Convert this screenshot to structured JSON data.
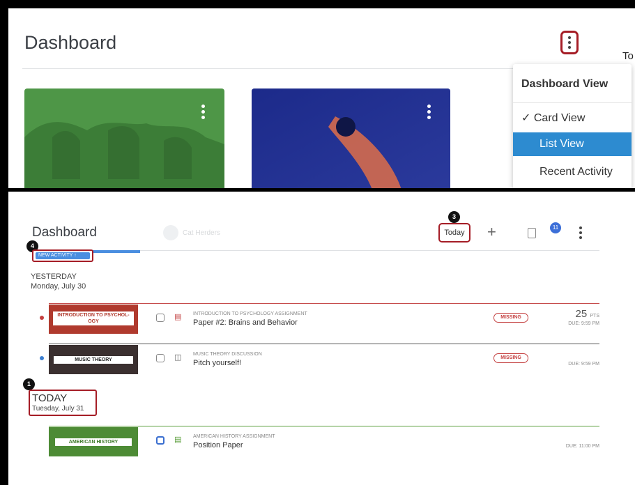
{
  "top": {
    "title": "Dashboard",
    "cut_text": "To",
    "dropdown": {
      "header": "Dashboard View",
      "items": [
        {
          "label": "Card View",
          "checked": true
        },
        {
          "label": "List View",
          "selected": true
        },
        {
          "label": "Recent Activity"
        }
      ]
    }
  },
  "bottom": {
    "title": "Dashboard",
    "faint_text": "Cat Herders",
    "today_button": "Today",
    "plus_icon": "+",
    "notifications_count": "11",
    "new_activity": "NEW ACTIVITY ↑",
    "yesterday": {
      "heading": "YESTERDAY",
      "date": "Monday, July 30"
    },
    "today": {
      "heading": "TODAY",
      "date": "Tuesday, July 31"
    },
    "steps": {
      "step1": "1",
      "step3": "3",
      "step4": "4"
    },
    "items": [
      {
        "course": "INTRODUCTION TO PSYCHOL- OGY",
        "kind": "INTRODUCTION TO PSYCHOLOGY ASSIGNMENT",
        "title": "Paper #2: Brains and Behavior",
        "missing": "MISSING",
        "points": "25",
        "points_unit": "PTS",
        "due": "DUE: 9:59 PM"
      },
      {
        "course": "MUSIC THEORY",
        "kind": "MUSIC THEORY DISCUSSION",
        "title": "Pitch yourself!",
        "missing": "MISSING",
        "due": "DUE: 9:59 PM"
      },
      {
        "course": "AMERICAN HISTORY",
        "kind": "AMERICAN HISTORY ASSIGNMENT",
        "title": "Position Paper",
        "due": "DUE: 11:00 PM"
      }
    ]
  },
  "colors": {
    "highlight": "#a51d26",
    "accent": "#2d8bd0"
  }
}
